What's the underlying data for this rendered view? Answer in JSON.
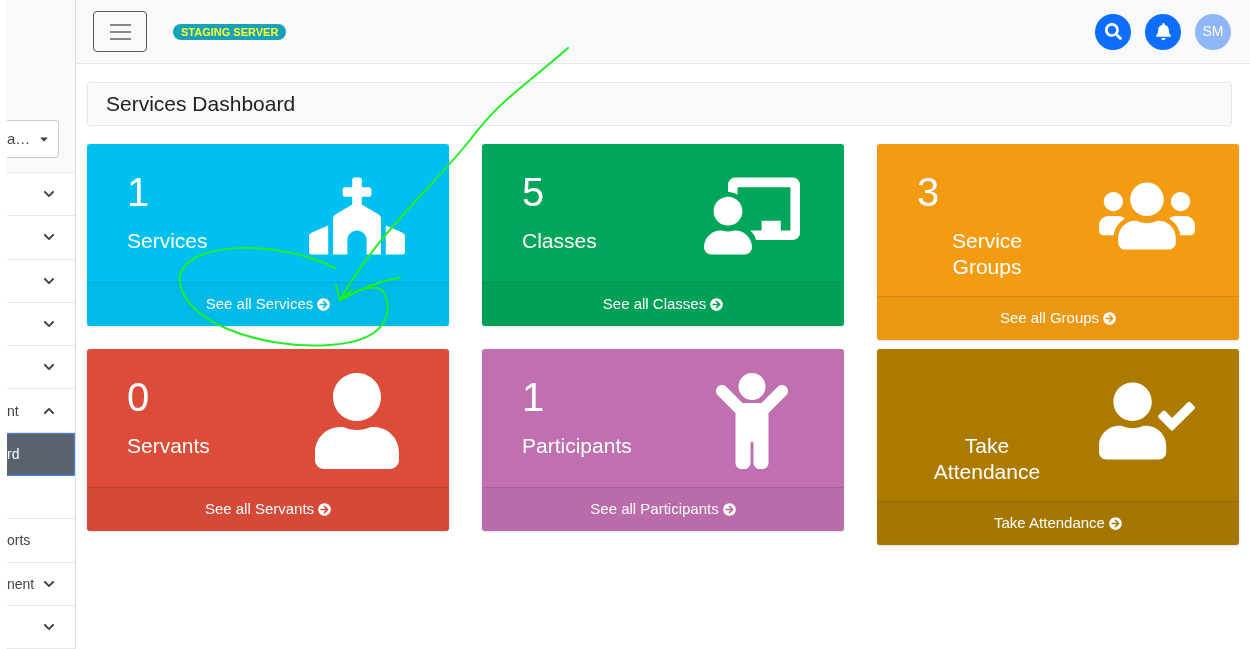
{
  "header": {
    "badge": "STAGING SERVER",
    "avatar": "SM"
  },
  "sidebar": {
    "selector": {
      "value": "a…"
    },
    "items": [
      {
        "kind": "group",
        "expanded": false,
        "selected": false
      },
      {
        "kind": "group",
        "expanded": false,
        "selected": false
      },
      {
        "kind": "group",
        "expanded": false,
        "selected": false
      },
      {
        "kind": "group",
        "expanded": false,
        "selected": false
      },
      {
        "kind": "group",
        "expanded": false,
        "selected": false
      },
      {
        "kind": "group",
        "label": "nt",
        "expanded": true,
        "selected": false
      },
      {
        "kind": "link",
        "label": "rd",
        "selected": true
      },
      {
        "kind": "link",
        "selected": false
      },
      {
        "kind": "link",
        "label": "orts",
        "selected": false
      },
      {
        "kind": "group",
        "label": "nent",
        "expanded": false,
        "selected": false
      },
      {
        "kind": "group",
        "expanded": false,
        "selected": false
      }
    ]
  },
  "page_title": "Services Dashboard",
  "cards": [
    {
      "count": "1",
      "title": "Services",
      "link": "See all Services",
      "color": "#00c0ef"
    },
    {
      "count": "5",
      "title": "Classes",
      "link": "See all Classes",
      "color": "#00a65a"
    },
    {
      "count": "3",
      "title": "Service Groups",
      "link": "See all Groups",
      "color": "#f39c12"
    },
    {
      "count": "0",
      "title": "Servants",
      "link": "See all Servants",
      "color": "#dd4b39"
    },
    {
      "count": "1",
      "title": "Participants",
      "link": "See all Participants",
      "color": "#c06fb0"
    },
    {
      "title": "Take Attendance",
      "link": "Take Attendance",
      "color": "#ad7a00"
    }
  ]
}
